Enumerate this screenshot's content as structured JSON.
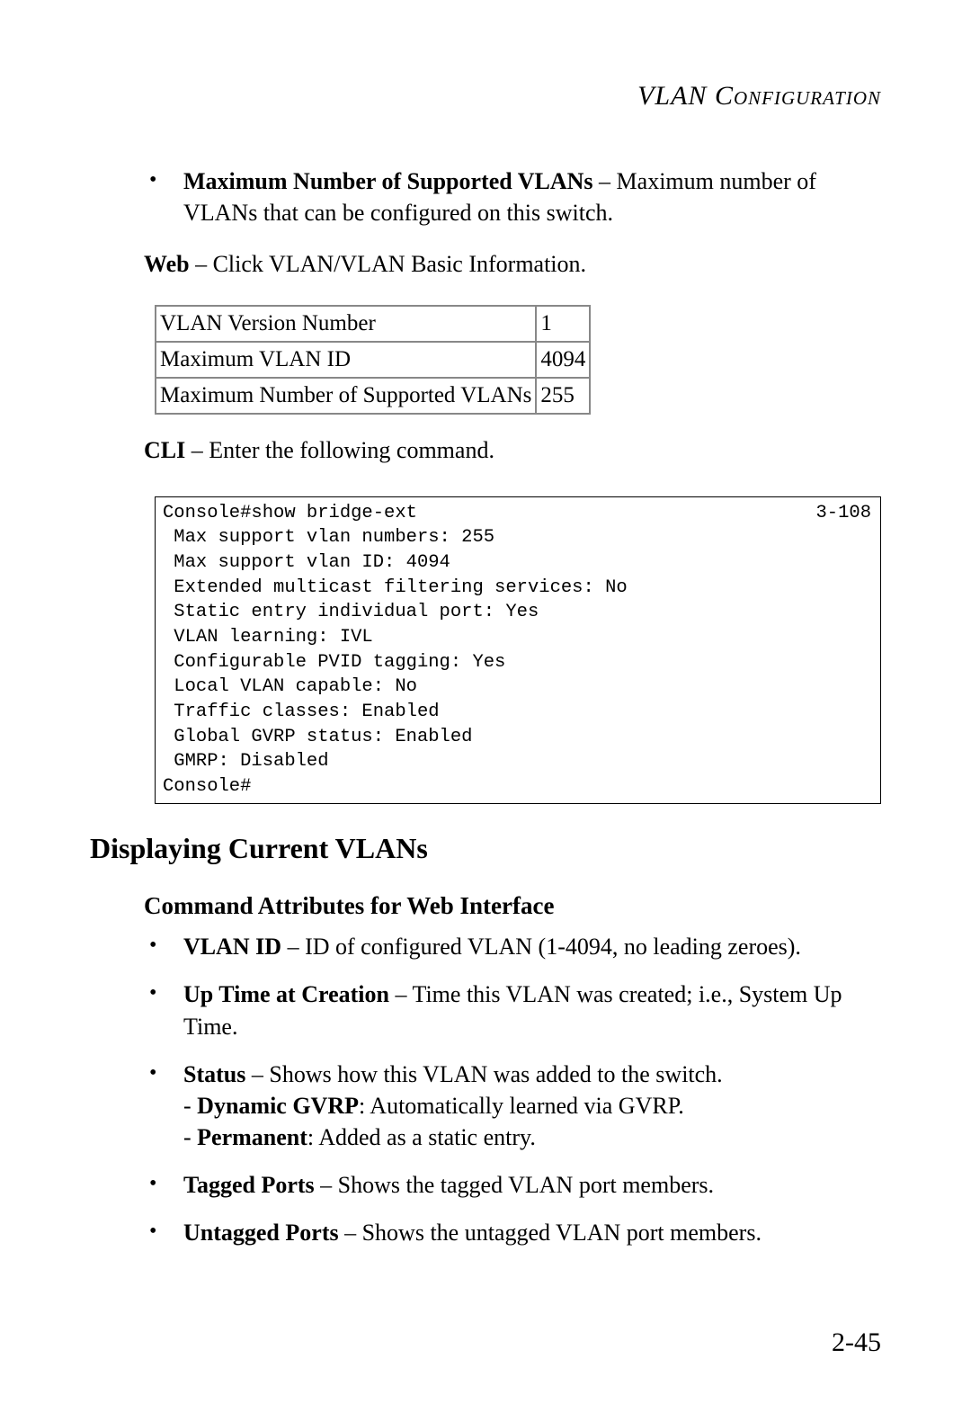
{
  "header": {
    "running_title": "VLAN Configuration"
  },
  "intro_bullet": {
    "label": "Maximum Number of Supported VLANs",
    "text": " – Maximum number of VLANs that can be configured on this switch."
  },
  "web_line": {
    "label": "Web",
    "text": " – Click VLAN/VLAN Basic Information."
  },
  "table": {
    "rows": [
      {
        "k": "VLAN Version Number",
        "v": "1"
      },
      {
        "k": "Maximum VLAN ID",
        "v": "4094"
      },
      {
        "k": "Maximum Number of Supported VLANs",
        "v": "255"
      }
    ]
  },
  "cli_line": {
    "label": "CLI",
    "text": " – Enter the following command."
  },
  "cli_output": {
    "ref": "3-108",
    "text": "Console#show bridge-ext\n Max support vlan numbers: 255\n Max support vlan ID: 4094\n Extended multicast filtering services: No\n Static entry individual port: Yes\n VLAN learning: IVL\n Configurable PVID tagging: Yes\n Local VLAN capable: No\n Traffic classes: Enabled\n Global GVRP status: Enabled\n GMRP: Disabled\nConsole#"
  },
  "section": {
    "title": "Displaying Current VLANs"
  },
  "subsection": {
    "title": "Command Attributes for Web Interface"
  },
  "attr_bullets": [
    {
      "label": "VLAN ID",
      "text": " – ID of configured VLAN (1-4094, no leading zeroes)."
    },
    {
      "label": "Up Time at Creation",
      "text": " – Time this VLAN was created; i.e., System Up Time."
    },
    {
      "label": "Status",
      "text": " – Shows how this VLAN was added to the switch.",
      "sub": [
        {
          "label": "Dynamic GVRP",
          "text": ": Automatically learned via GVRP."
        },
        {
          "label": "Permanent",
          "text": ": Added as a static entry."
        }
      ]
    },
    {
      "label": "Tagged Ports",
      "text": " – Shows the tagged VLAN port members."
    },
    {
      "label": "Untagged Ports",
      "text": " – Shows the untagged VLAN port members."
    }
  ],
  "page_number": "2-45"
}
